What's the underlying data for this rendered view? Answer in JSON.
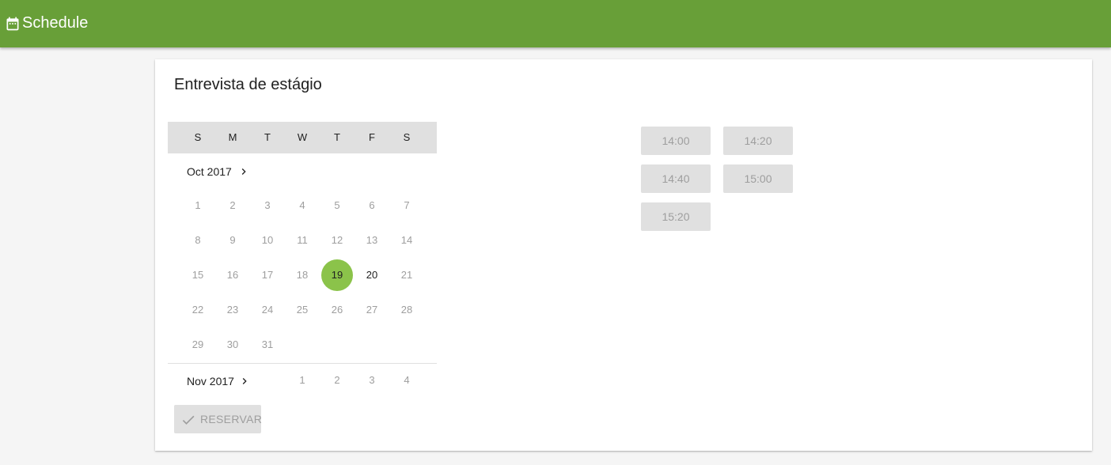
{
  "app": {
    "title": "Schedule",
    "icon": "calendar-icon",
    "brand_color": "#689f38"
  },
  "card": {
    "title": "Entrevista de estágio"
  },
  "calendar": {
    "weekdays": [
      "S",
      "M",
      "T",
      "W",
      "T",
      "F",
      "S"
    ],
    "selected_color": "#8bc34a",
    "months": [
      {
        "label": "Oct 2017",
        "rows": [
          [
            "1",
            "2",
            "3",
            "4",
            "5",
            "6",
            "7"
          ],
          [
            "8",
            "9",
            "10",
            "11",
            "12",
            "13",
            "14"
          ],
          [
            "15",
            "16",
            "17",
            "18",
            "19",
            "20",
            "21"
          ],
          [
            "22",
            "23",
            "24",
            "25",
            "26",
            "27",
            "28"
          ],
          [
            "29",
            "30",
            "31"
          ]
        ],
        "selected_day": "19",
        "available_days": [
          "19",
          "20"
        ]
      },
      {
        "label": "Nov 2017",
        "first_row": [
          "1",
          "2",
          "3",
          "4"
        ]
      }
    ]
  },
  "actions": {
    "reserve_label": "RESERVAR",
    "reserve_icon": "check-icon"
  },
  "time_slots": [
    "14:00",
    "14:20",
    "14:40",
    "15:00",
    "15:20"
  ]
}
